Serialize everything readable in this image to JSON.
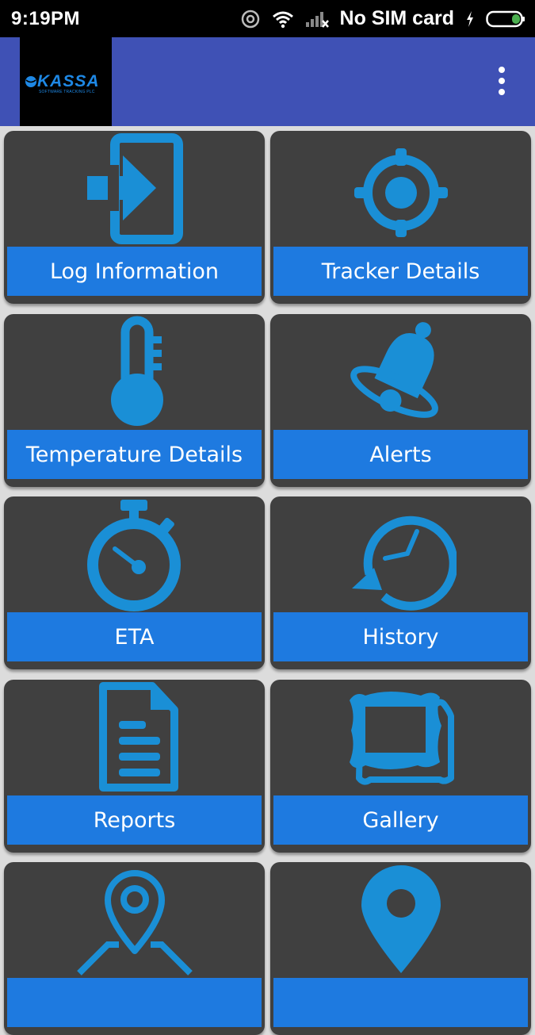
{
  "status_bar": {
    "time": "9:19PM",
    "carrier": "No SIM card",
    "icons": [
      "hotspot-icon",
      "wifi-icon",
      "signal-icon",
      "charging-icon",
      "battery-icon"
    ]
  },
  "app_bar": {
    "logo_text": "KASSA",
    "logo_subtitle": "SOFTWARE TRACKING PLC",
    "menu_icon": "overflow-menu-icon"
  },
  "tiles": [
    {
      "label": "Log Information",
      "icon": "login-icon"
    },
    {
      "label": "Tracker Details",
      "icon": "crosshair-icon"
    },
    {
      "label": "Temperature Details",
      "icon": "thermometer-icon"
    },
    {
      "label": "Alerts",
      "icon": "bell-icon"
    },
    {
      "label": "ETA",
      "icon": "stopwatch-icon"
    },
    {
      "label": "History",
      "icon": "history-icon"
    },
    {
      "label": "Reports",
      "icon": "document-icon"
    },
    {
      "label": "Gallery",
      "icon": "picture-frame-icon"
    },
    {
      "label": "",
      "icon": "map-location-icon"
    },
    {
      "label": "",
      "icon": "location-pin-icon"
    }
  ],
  "colors": {
    "app_bar": "#3f51b5",
    "tile_bg": "#404040",
    "label_bg": "#1e7ae0",
    "icon": "#1a8fd6"
  }
}
